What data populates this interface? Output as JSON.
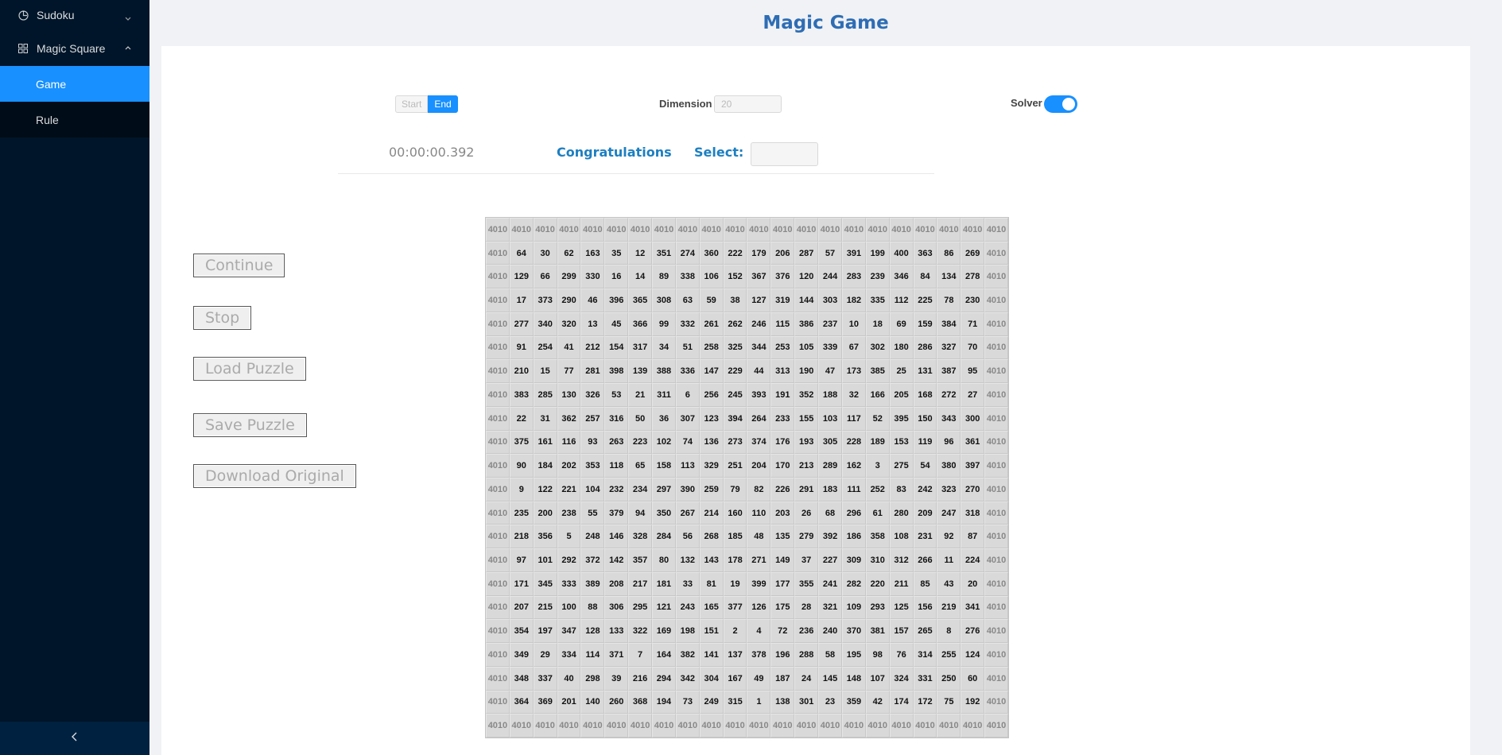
{
  "sidebar": {
    "sudoku_label": "Sudoku",
    "magic_square_label": "Magic Square",
    "items": [
      {
        "label": "Game",
        "active": true
      },
      {
        "label": "Rule",
        "active": false
      }
    ],
    "colors": {
      "bg": "#001529",
      "active": "#1890ff"
    }
  },
  "header": {
    "title": "Magic Game"
  },
  "controls": {
    "start_label": "Start",
    "end_label": "End",
    "dimension_label": "Dimension",
    "dimension_placeholder": "20",
    "solver_label": "Solver",
    "solver_on": true,
    "timer": "00:00:00.392",
    "status": "Congratulations",
    "select_label": "Select:"
  },
  "actions": {
    "continue": "Continue",
    "stop": "Stop",
    "load": "Load Puzzle",
    "save": "Save Puzzle",
    "download": "Download Original"
  },
  "grid": {
    "sum": "4010",
    "rows": [
      [
        64,
        30,
        62,
        163,
        35,
        12,
        351,
        274,
        360,
        222,
        179,
        206,
        287,
        57,
        391,
        199,
        400,
        363,
        86,
        269
      ],
      [
        129,
        66,
        299,
        330,
        16,
        14,
        89,
        338,
        106,
        152,
        367,
        376,
        120,
        244,
        283,
        239,
        346,
        84,
        134,
        278
      ],
      [
        17,
        373,
        290,
        46,
        396,
        365,
        308,
        63,
        59,
        38,
        127,
        319,
        144,
        303,
        182,
        335,
        112,
        225,
        78,
        230
      ],
      [
        277,
        340,
        320,
        13,
        45,
        366,
        99,
        332,
        261,
        262,
        246,
        115,
        386,
        237,
        10,
        18,
        69,
        159,
        384,
        71
      ],
      [
        91,
        254,
        41,
        212,
        154,
        317,
        34,
        51,
        258,
        325,
        344,
        253,
        105,
        339,
        67,
        302,
        180,
        286,
        327,
        70
      ],
      [
        210,
        15,
        77,
        281,
        398,
        139,
        388,
        336,
        147,
        229,
        44,
        313,
        190,
        47,
        173,
        385,
        25,
        131,
        387,
        95
      ],
      [
        383,
        285,
        130,
        326,
        53,
        21,
        311,
        6,
        256,
        245,
        393,
        191,
        352,
        188,
        32,
        166,
        205,
        168,
        272,
        27
      ],
      [
        22,
        31,
        362,
        257,
        316,
        50,
        36,
        307,
        123,
        394,
        264,
        233,
        155,
        103,
        117,
        52,
        395,
        150,
        343,
        300
      ],
      [
        375,
        161,
        116,
        93,
        263,
        223,
        102,
        74,
        136,
        273,
        374,
        176,
        193,
        305,
        228,
        189,
        153,
        119,
        96,
        361
      ],
      [
        90,
        184,
        202,
        353,
        118,
        65,
        158,
        113,
        329,
        251,
        204,
        170,
        213,
        289,
        162,
        3,
        275,
        54,
        380,
        397
      ],
      [
        9,
        122,
        221,
        104,
        232,
        234,
        297,
        390,
        259,
        79,
        82,
        226,
        291,
        183,
        111,
        252,
        83,
        242,
        323,
        270
      ],
      [
        235,
        200,
        238,
        55,
        379,
        94,
        350,
        267,
        214,
        160,
        110,
        203,
        26,
        68,
        296,
        61,
        280,
        209,
        247,
        318
      ],
      [
        218,
        356,
        5,
        248,
        146,
        328,
        284,
        56,
        268,
        185,
        48,
        135,
        279,
        392,
        186,
        358,
        108,
        231,
        92,
        87
      ],
      [
        97,
        101,
        292,
        372,
        142,
        357,
        80,
        132,
        143,
        178,
        271,
        149,
        37,
        227,
        309,
        310,
        312,
        266,
        11,
        224
      ],
      [
        171,
        345,
        333,
        389,
        208,
        217,
        181,
        33,
        81,
        19,
        399,
        177,
        355,
        241,
        282,
        220,
        211,
        85,
        43,
        20
      ],
      [
        207,
        215,
        100,
        88,
        306,
        295,
        121,
        243,
        165,
        377,
        126,
        175,
        28,
        321,
        109,
        293,
        125,
        156,
        219,
        341
      ],
      [
        354,
        197,
        347,
        128,
        133,
        322,
        169,
        198,
        151,
        2,
        4,
        72,
        236,
        240,
        370,
        381,
        157,
        265,
        8,
        276
      ],
      [
        349,
        29,
        334,
        114,
        371,
        7,
        164,
        382,
        141,
        137,
        378,
        196,
        288,
        58,
        195,
        98,
        76,
        314,
        255,
        124
      ],
      [
        348,
        337,
        40,
        298,
        39,
        216,
        294,
        342,
        304,
        167,
        49,
        187,
        24,
        145,
        148,
        107,
        324,
        331,
        250,
        60
      ],
      [
        364,
        369,
        201,
        140,
        260,
        368,
        194,
        73,
        249,
        315,
        1,
        138,
        301,
        23,
        359,
        42,
        174,
        172,
        75,
        192
      ]
    ]
  }
}
